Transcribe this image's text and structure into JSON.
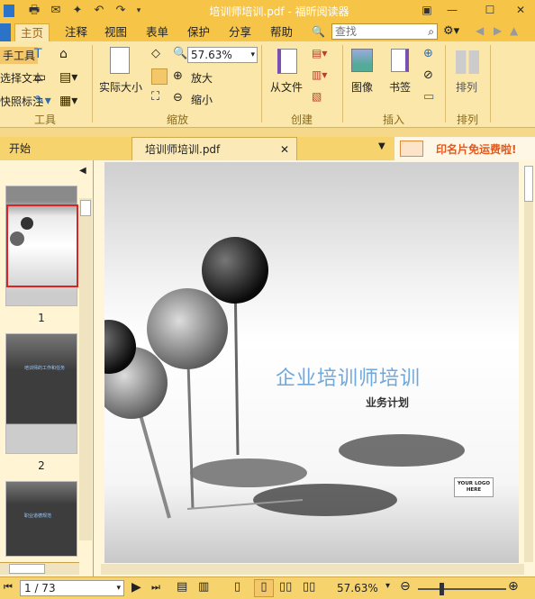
{
  "window": {
    "title": "培训师培训.pdf - 福昕阅读器"
  },
  "menu": {
    "tabs": [
      "主页",
      "注释",
      "视图",
      "表单",
      "保护",
      "分享",
      "帮助"
    ],
    "active": "主页"
  },
  "search": {
    "placeholder": "查找"
  },
  "ribbon": {
    "tools": {
      "items": [
        "手工具",
        "选择文本",
        "快照标注"
      ],
      "label": "工具"
    },
    "zoom": {
      "actual_size": "实际大小",
      "value": "57.63%",
      "zoom_in": "放大",
      "zoom_out": "缩小",
      "label": "缩放"
    },
    "create": {
      "from_file": "从文件",
      "label": "创建"
    },
    "insert": {
      "image": "图像",
      "bookmark": "书签",
      "label": "插入"
    },
    "arrange": {
      "label": "排列",
      "button": "排列"
    }
  },
  "doctabs": {
    "start": "开始",
    "file": "培训师培训.pdf",
    "ad": "印名片免运费啦!"
  },
  "thumbnails": {
    "pages": [
      "1",
      "2"
    ],
    "thumb2_title": "培训师的工作和任务",
    "thumb3_title": "职业道德规范"
  },
  "document": {
    "title": "企业培训师培训",
    "subtitle": "业务计划",
    "logo": "YOUR LOGO HERE"
  },
  "status": {
    "page": "1 / 73",
    "zoom": "57.63%"
  },
  "colors": {
    "accent": "#f6c548",
    "ribbon": "#fbe7aa",
    "title_blue": "#6fa8dc"
  }
}
